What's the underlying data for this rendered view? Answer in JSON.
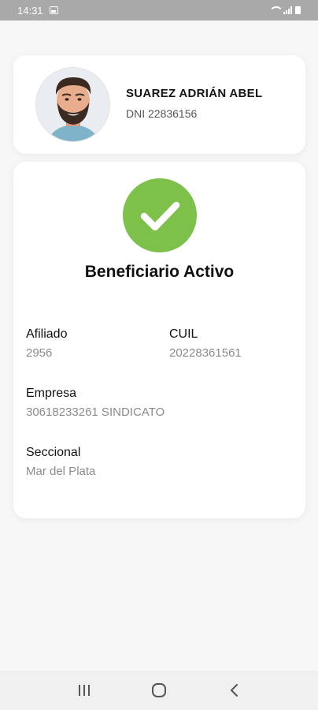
{
  "status_bar": {
    "time": "14:31"
  },
  "profile": {
    "name": "SUAREZ ADRIÁN ABEL",
    "dni": "DNI 22836156"
  },
  "status": {
    "title": "Beneficiario Activo",
    "accent_color": "#7dc14b"
  },
  "fields": {
    "afiliado": {
      "label": "Afiliado",
      "value": "2956"
    },
    "cuil": {
      "label": "CUIL",
      "value": "20228361561"
    },
    "empresa": {
      "label": "Empresa",
      "value": "30618233261 SINDICATO"
    },
    "seccional": {
      "label": "Seccional",
      "value": "Mar del Plata"
    }
  },
  "nav": {
    "recents_icon": "recents-icon",
    "home_icon": "home-icon",
    "back_icon": "back-icon"
  }
}
